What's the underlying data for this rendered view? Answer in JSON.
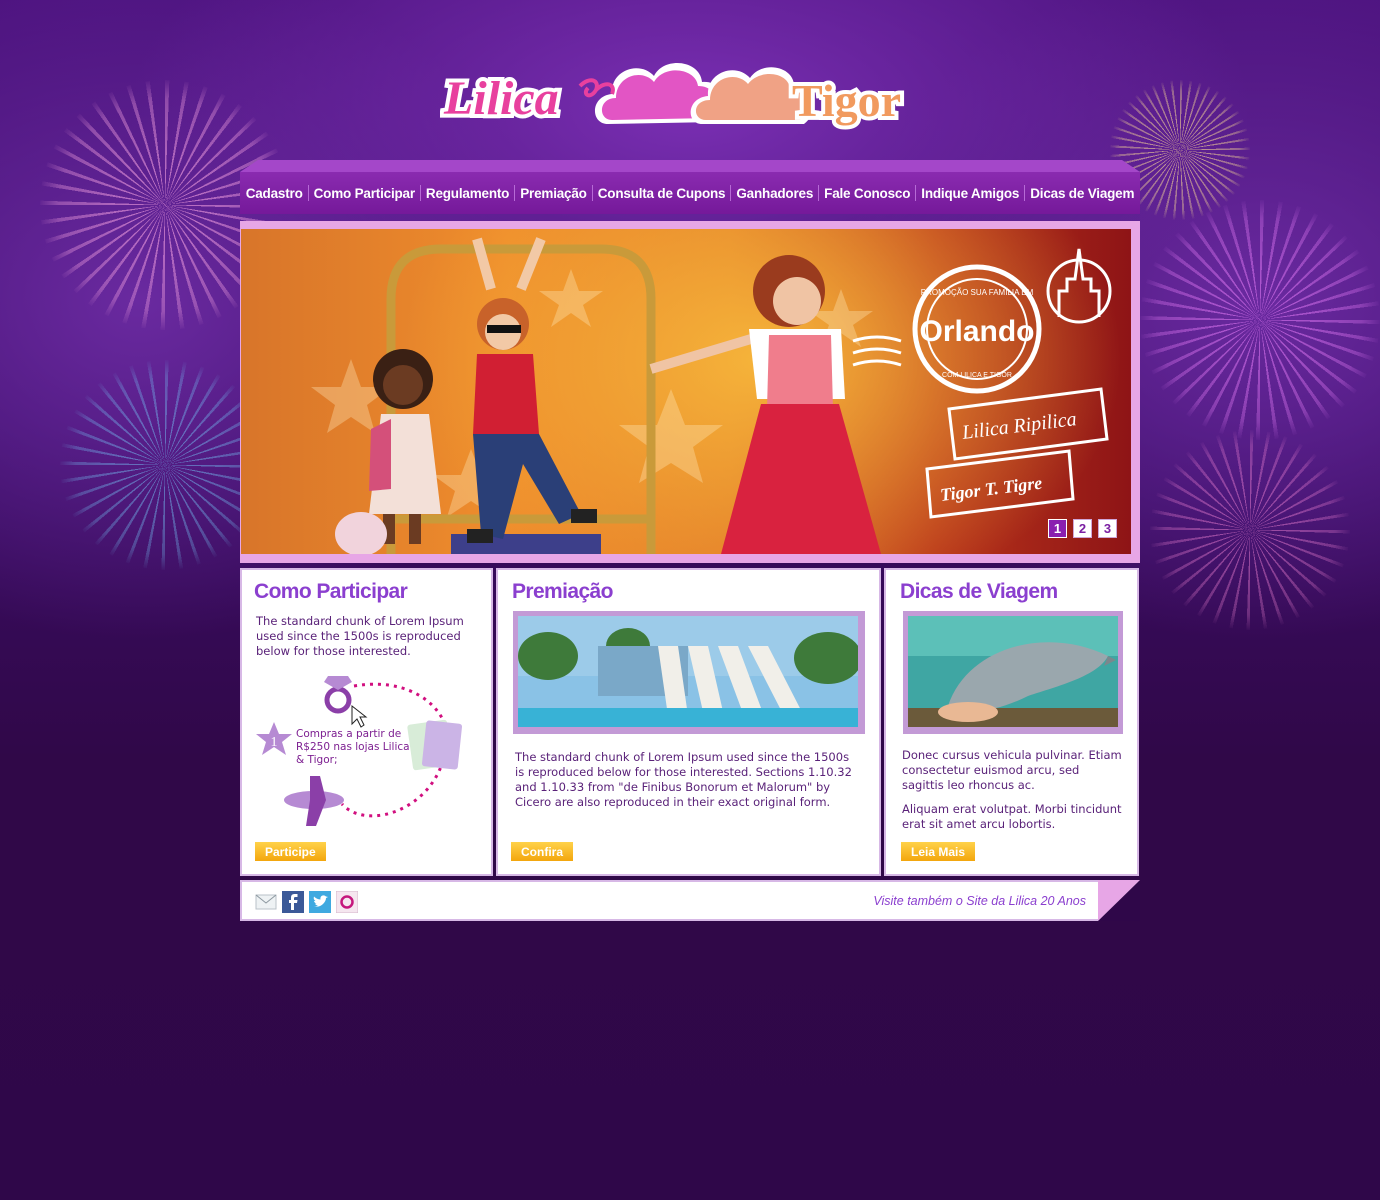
{
  "brand": {
    "left": "Lilica",
    "right": "Tigor"
  },
  "nav": {
    "items": [
      "Cadastro",
      "Como Participar",
      "Regulamento",
      "Premiação",
      "Consulta de Cupons",
      "Ganhadores",
      "Fale Conosco",
      "Indique Amigos",
      "Dicas de Viagem"
    ]
  },
  "banner": {
    "stamp_top": "PROMOÇÃO SUA FAMÍLIA EM",
    "stamp_main": "Orlando",
    "stamp_bottom": "COM LILICA E TIGOR",
    "tag1": "Lilica Ripilica",
    "tag2": "Tigor T. Tigre",
    "pager": [
      "1",
      "2",
      "3"
    ],
    "active_page": "1"
  },
  "como_participar": {
    "title": "Como Participar",
    "text": "The standard chunk of Lorem Ipsum used since the 1500s is reproduced below for those interested.",
    "step_number": "1",
    "step_text": "Compras a partir de R$250 nas lojas Lilica & Tigor;",
    "button": "Participe"
  },
  "premiacao": {
    "title": "Premiação",
    "text": "The standard chunk of Lorem Ipsum used since the 1500s is reproduced below for those interested. Sections 1.10.32 and 1.10.33 from \"de Finibus Bonorum et Malorum\" by Cicero are also reproduced in their exact original form.",
    "button": "Confira"
  },
  "dicas": {
    "title": "Dicas de Viagem",
    "text1": "Donec cursus vehicula pulvinar. Etiam consectetur euismod arcu, sed sagittis leo rhoncus ac.",
    "text2": "Aliquam erat volutpat. Morbi tincidunt erat sit amet arcu lobortis.",
    "button": "Leia Mais"
  },
  "footer": {
    "social_icons": [
      "email-icon",
      "facebook-icon",
      "twitter-icon",
      "orkut-icon"
    ],
    "link": "Visite também o Site da Lilica 20 Anos"
  },
  "colors": {
    "background": "#3c0d68",
    "nav": "#8a2bb0",
    "accent_purple": "#8b3fcf",
    "button_yellow": "#f3a60d",
    "frame_pink": "#e7a6e6"
  }
}
